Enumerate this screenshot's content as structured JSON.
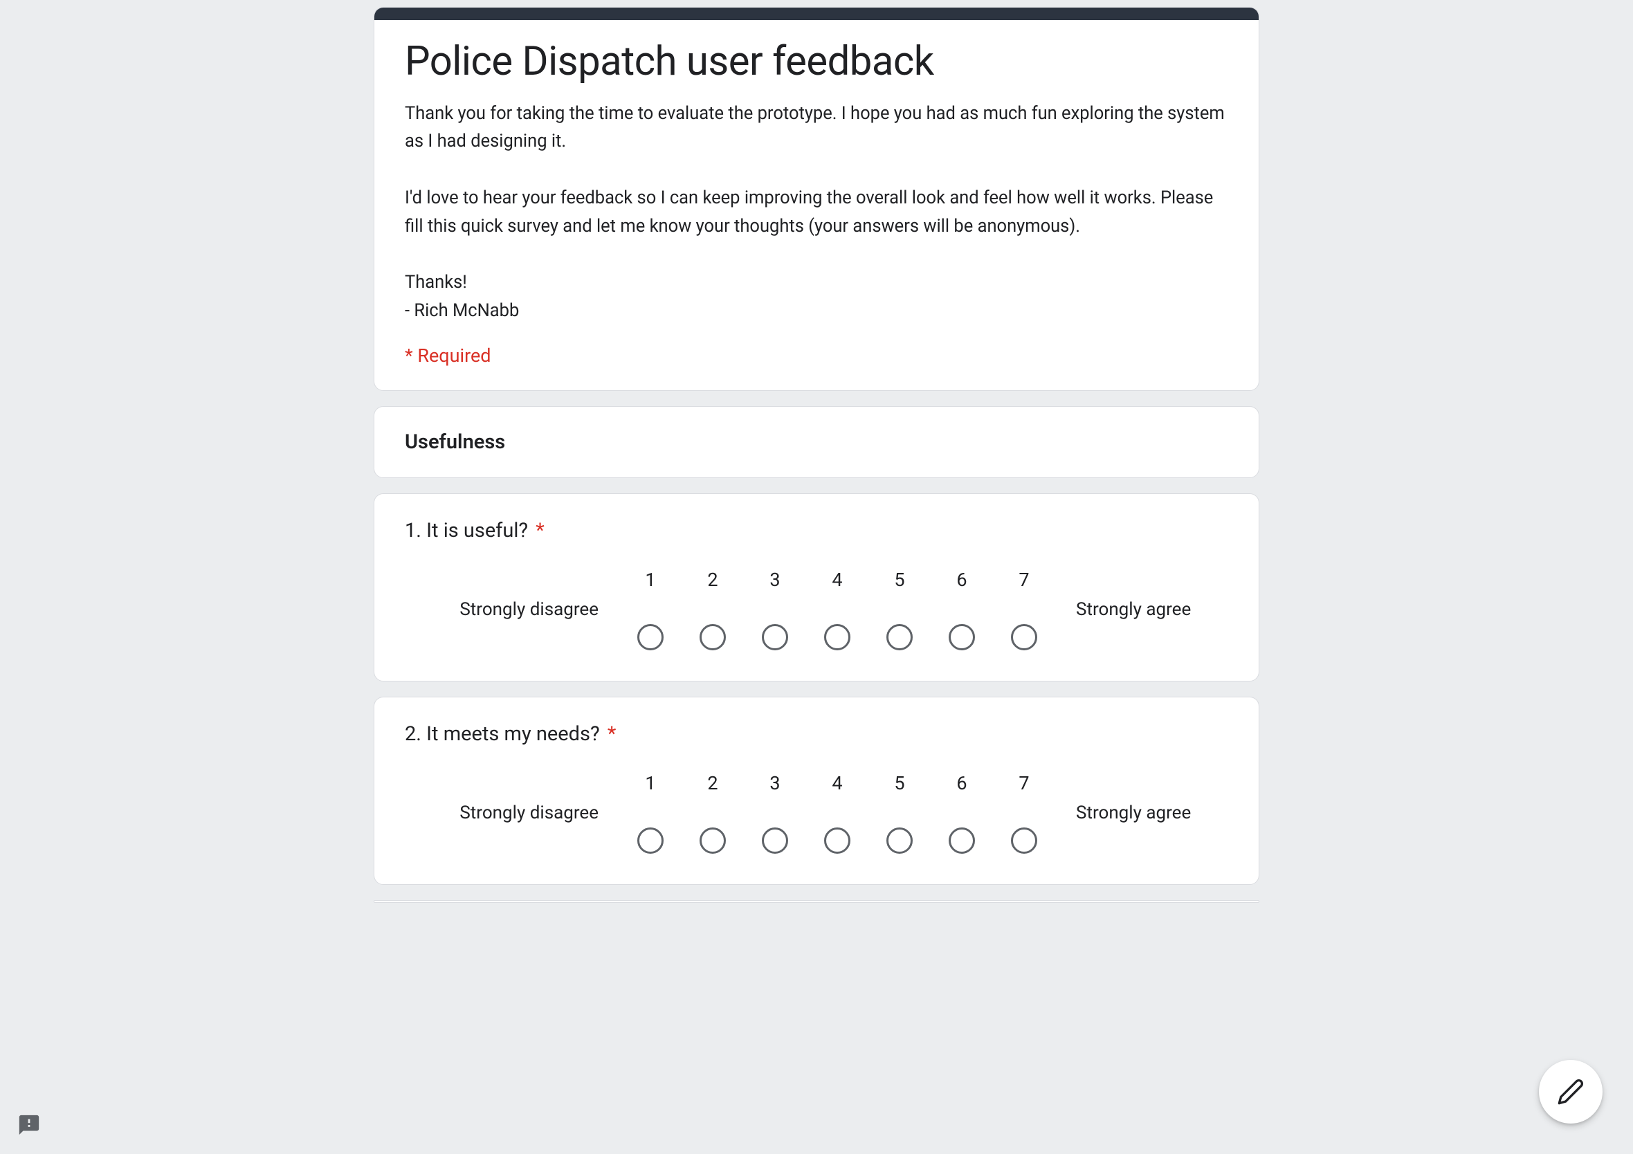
{
  "header": {
    "title": "Police Dispatch user feedback",
    "description": "Thank you for taking the time to evaluate the prototype. I hope you had as much fun exploring the system as I had designing it.\n\nI'd love to hear your feedback so I can keep improving the overall look and feel how well it works. Please fill this quick survey and let me know your thoughts (your answers will be anonymous).\n\nThanks!\n- Rich McNabb",
    "required_note": "* Required"
  },
  "section": {
    "title": "Usefulness"
  },
  "scale": {
    "numbers": [
      "1",
      "2",
      "3",
      "4",
      "5",
      "6",
      "7"
    ],
    "low_label": "Strongly disagree",
    "high_label": "Strongly agree"
  },
  "questions": [
    {
      "title": "1. It is useful?",
      "required": true
    },
    {
      "title": "2. It meets my needs?",
      "required": true
    }
  ],
  "required_marker": "*"
}
